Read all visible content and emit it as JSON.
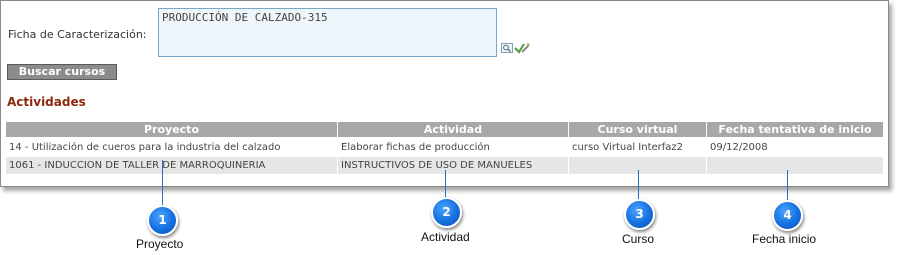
{
  "ficha": {
    "label": "Ficha de Caracterización:",
    "value": "PRODUCCIÓN DE CALZADO-315",
    "search_icon": "magnifier-icon",
    "select_icon": "check-pencil-icon"
  },
  "buttons": {
    "buscar": "Buscar cursos"
  },
  "section": {
    "title": "Actividades"
  },
  "table": {
    "headers": [
      "Proyecto",
      "Actividad",
      "Curso virtual",
      "Fecha tentativa de inicio"
    ],
    "rows": [
      [
        "14 - Utilización de cueros para la industria del calzado",
        "Elaborar fichas de producción",
        "curso Virtual Interfaz2",
        "09/12/2008"
      ],
      [
        "1061 - INDUCCION DE TALLER DE MARROQUINERIA",
        "INSTRUCTIVOS DE USO DE MANUELES",
        "",
        ""
      ]
    ]
  },
  "callouts": [
    {
      "number": "1",
      "caption": "Proyecto"
    },
    {
      "number": "2",
      "caption": "Actividad"
    },
    {
      "number": "3",
      "caption": "Curso"
    },
    {
      "number": "4",
      "caption": "Fecha inicio"
    }
  ],
  "colors": {
    "accent": "#8b2a0c",
    "callout": "#1570e0",
    "header_bg": "#a8a8a8"
  }
}
